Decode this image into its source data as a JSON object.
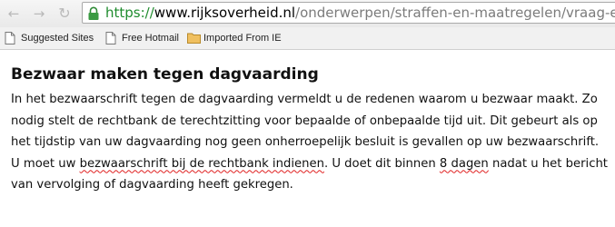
{
  "browser": {
    "url": {
      "scheme": "https://",
      "host": "www.rijksoverheid.nl",
      "path": "/onderwerpen/straffen-en-maatregelen/vraag-en-antwoord"
    },
    "bookmarks": [
      {
        "label": "Suggested Sites",
        "icon": "page-icon"
      },
      {
        "label": "Free Hotmail",
        "icon": "page-icon"
      },
      {
        "label": "Imported From IE",
        "icon": "folder-icon"
      }
    ]
  },
  "article": {
    "heading": "Bezwaar maken tegen dagvaarding",
    "lines": [
      "In het bezwaarschrift tegen de dagvaarding vermeldt u de redenen waarom u bezwaar maakt. Zo",
      "nodig stelt de rechtbank de terechtzitting voor bepaalde of onbepaalde tijd uit. Dit gebeurt als op",
      "het tijdstip van uw dagvaarding nog geen onherroepelijk besluit is gevallen op uw bezwaarschrift.",
      {
        "a": "U moet uw ",
        "b": "bezwaarschrift bij de rechtbank indienen",
        "c": ". U doet dit binnen ",
        "d": "8 dagen",
        "e": " nadat u het bericht"
      },
      "van vervolging of dagvaarding heeft gekregen."
    ]
  },
  "colors": {
    "url_scheme": "#1f8c2e",
    "url_path": "#7b7b7b",
    "squiggle": "#e02020"
  }
}
